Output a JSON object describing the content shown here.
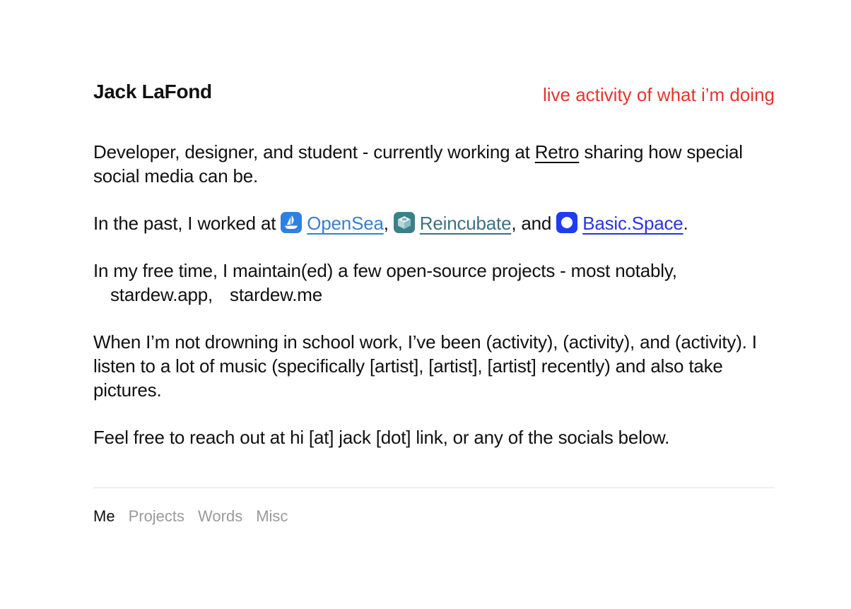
{
  "header": {
    "name": "Jack LaFond",
    "live_activity": "live activity of what i’m doing"
  },
  "colors": {
    "live_activity": "#e5352c",
    "opensea": "#2f80e0",
    "reincubate": "#3b7f89",
    "basic_space": "#1f3df0",
    "nav_inactive": "#9a9a9a"
  },
  "intro": {
    "before": "Developer, designer, and student - currently working at ",
    "link": "Retro",
    "after": " sharing how special social media can be."
  },
  "past": {
    "before": "In the past, I worked at ",
    "companies": [
      {
        "name": "OpenSea",
        "icon": "opensea-icon"
      },
      {
        "name": "Reincubate",
        "icon": "reincubate-icon"
      },
      {
        "name": "Basic.Space",
        "icon": "basic-space-icon"
      }
    ],
    "sep1": ", ",
    "sep2": ", and ",
    "end": "."
  },
  "free_time": {
    "before": "In my free time, I maintain(ed) a few open-source projects - most notably,",
    "projects": [
      "stardew.app,",
      "stardew.me"
    ]
  },
  "hobbies": {
    "text": "When I’m not drowning in school work, I’ve been (activity), (activity), and (activity). I listen to a lot of music (specifically [artist], [artist], [artist] recently) and also take pictures."
  },
  "contact": {
    "text": "Feel free to reach out at hi [at] jack [dot] link, or any of the socials below."
  },
  "nav": {
    "items": [
      "Me",
      "Projects",
      "Words",
      "Misc"
    ],
    "active": "Me"
  }
}
